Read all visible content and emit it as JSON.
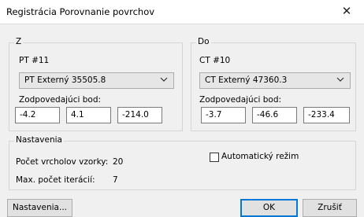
{
  "window": {
    "title": "Registrácia Porovnanie povrchov",
    "close_glyph": "✕"
  },
  "from_group": {
    "title": "Z",
    "point_label": "PT #11",
    "combo_value": "PT Externý  35505.8",
    "corresponding_label": "Zodpovedajúci bod:",
    "coords": [
      "-4.2",
      "4.1",
      "-214.0"
    ]
  },
  "to_group": {
    "title": "Do",
    "point_label": "CT #10",
    "combo_value": "CT Externý  47360.3",
    "corresponding_label": "Zodpovedajúci bod:",
    "coords": [
      "-3.7",
      "-46.6",
      "-233.4"
    ]
  },
  "settings_group": {
    "title": "Nastavenia",
    "sample_vertices_label": "Počet vrcholov vzorky:",
    "sample_vertices_value": "20",
    "max_iterations_label": "Max. počet iterácií:",
    "max_iterations_value": "7",
    "auto_mode_label": "Automatický režim",
    "auto_mode_checked": false
  },
  "buttons": {
    "settings": "Nastavenia...",
    "ok": "OK",
    "cancel": "Zrušiť"
  },
  "colors": {
    "default_button_border": "#0078d7",
    "dialog_background": "#f0f0f0"
  }
}
